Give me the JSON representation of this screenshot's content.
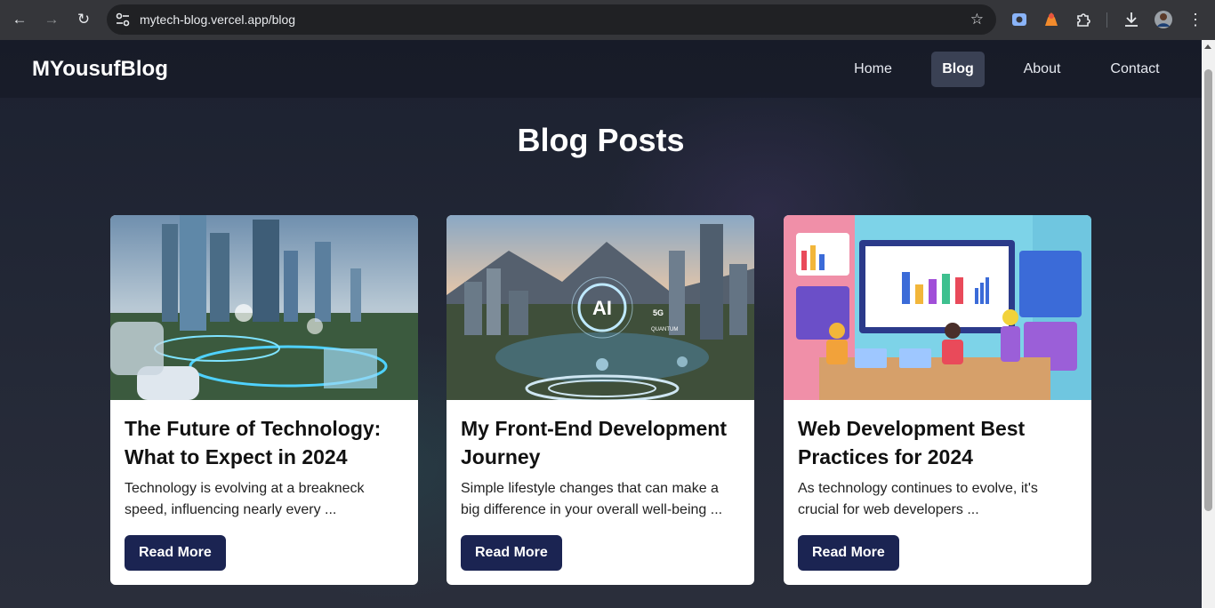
{
  "browser": {
    "url": "mytech-blog.vercel.app/blog",
    "icons": [
      "back-arrow-icon",
      "forward-arrow-icon",
      "reload-icon",
      "site-info-icon",
      "bookmark-star-icon",
      "screen-capture-extension-icon",
      "fox-extension-icon",
      "extensions-puzzle-icon",
      "download-icon",
      "profile-avatar-icon",
      "more-menu-icon"
    ]
  },
  "site": {
    "brand": "MYousufBlog",
    "nav": [
      {
        "label": "Home"
      },
      {
        "label": "Blog"
      },
      {
        "label": "About"
      },
      {
        "label": "Contact"
      }
    ]
  },
  "page": {
    "title": "Blog Posts"
  },
  "posts": [
    {
      "title": "The Future of Technology: What to Expect in 2024",
      "excerpt": "Technology is evolving at a breakneck speed, influencing nearly every ...",
      "button": "Read More"
    },
    {
      "title": "My Front-End Development Journey",
      "excerpt": "Simple lifestyle changes that can make a big difference in your overall well-being ...",
      "button": "Read More",
      "image_text": {
        "ai": "AI",
        "fiveg": "5G",
        "quantum": "QUANTUM"
      }
    },
    {
      "title": "Web Development Best Practices for 2024",
      "excerpt": "As technology continues to evolve, it's crucial for web developers ...",
      "button": "Read More"
    }
  ],
  "colors": {
    "page_bg": "#1f2330",
    "button_bg": "#1b2452",
    "nav_active_bg": "#3a4154",
    "card_bg": "#ffffff"
  }
}
